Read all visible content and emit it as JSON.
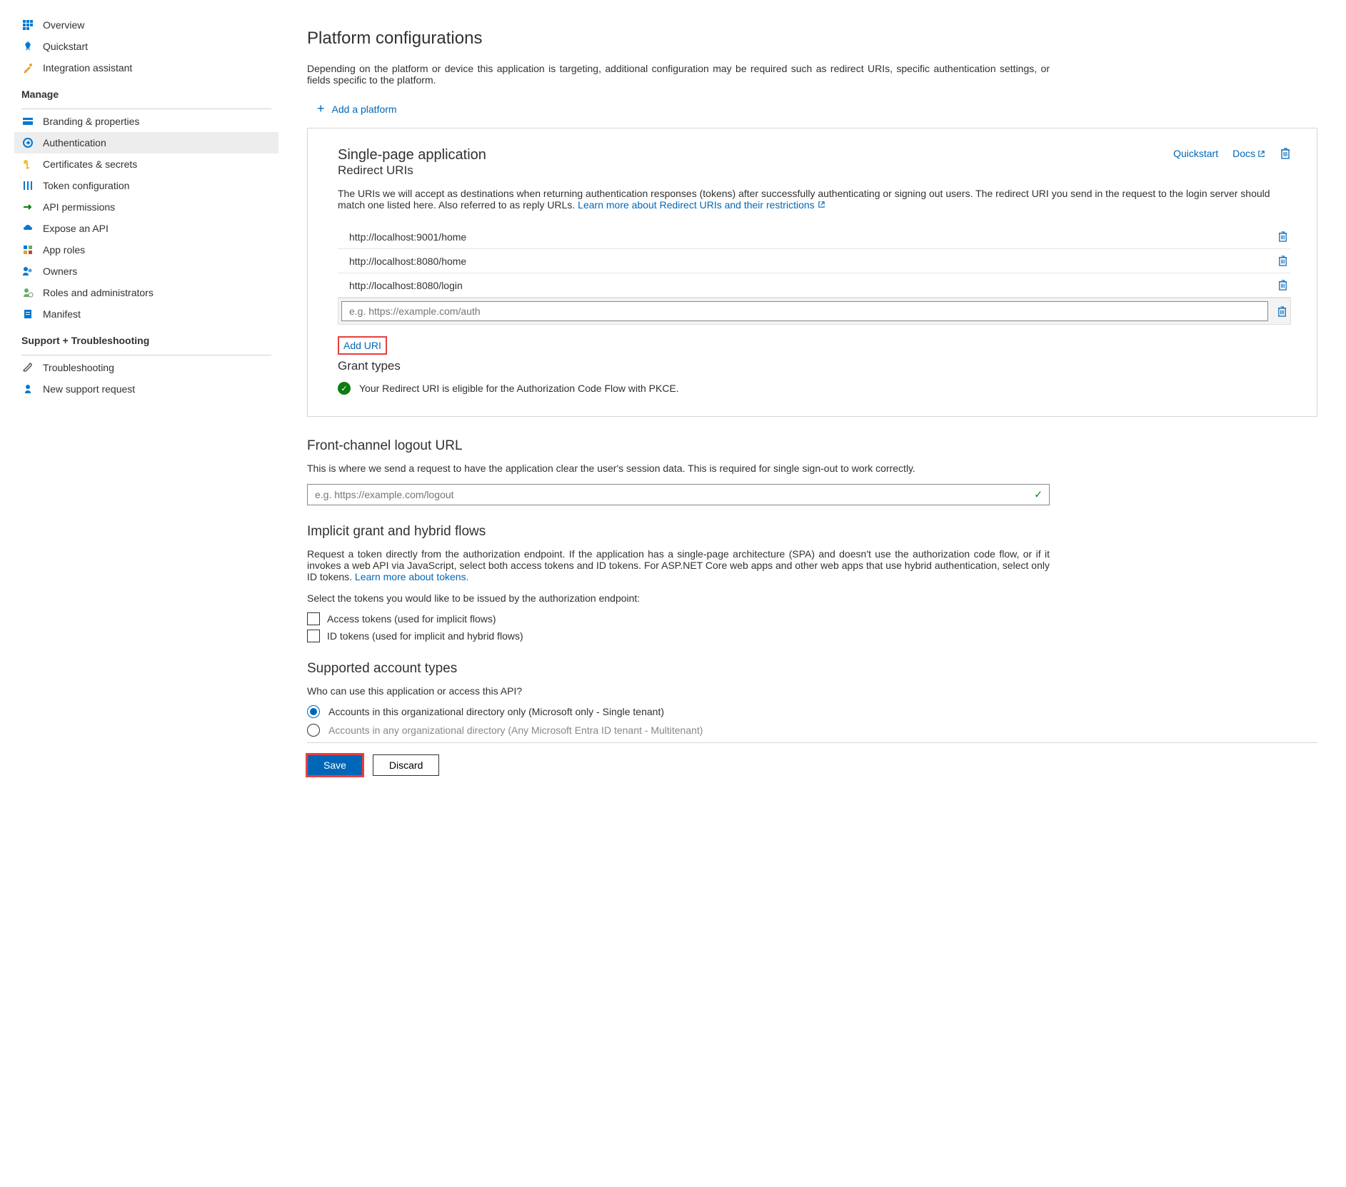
{
  "sidebar": {
    "overview": "Overview",
    "quickstart": "Quickstart",
    "integration": "Integration assistant",
    "manage_header": "Manage",
    "branding": "Branding & properties",
    "authentication": "Authentication",
    "certificates": "Certificates & secrets",
    "token_config": "Token configuration",
    "api_permissions": "API permissions",
    "expose_api": "Expose an API",
    "app_roles": "App roles",
    "owners": "Owners",
    "roles_admins": "Roles and administrators",
    "manifest": "Manifest",
    "support_header": "Support + Troubleshooting",
    "troubleshooting": "Troubleshooting",
    "new_support": "New support request"
  },
  "main": {
    "title": "Platform configurations",
    "description": "Depending on the platform or device this application is targeting, additional configuration may be required such as redirect URIs, specific authentication settings, or fields specific to the platform.",
    "add_platform": "Add a platform"
  },
  "spa": {
    "title": "Single-page application",
    "quickstart_link": "Quickstart",
    "docs_link": "Docs",
    "redirect_heading": "Redirect URIs",
    "redirect_desc": "The URIs we will accept as destinations when returning authentication responses (tokens) after successfully authenticating or signing out users. The redirect URI you send in the request to the login server should match one listed here. Also referred to as reply URLs. ",
    "learn_more_link": "Learn more about Redirect URIs and their restrictions",
    "uris": [
      "http://localhost:9001/home",
      "http://localhost:8080/home",
      "http://localhost:8080/login"
    ],
    "uri_placeholder": "e.g. https://example.com/auth",
    "add_uri": "Add URI",
    "grant_heading": "Grant types",
    "eligible_msg": "Your Redirect URI is eligible for the Authorization Code Flow with PKCE."
  },
  "logout": {
    "heading": "Front-channel logout URL",
    "desc": "This is where we send a request to have the application clear the user's session data. This is required for single sign-out to work correctly.",
    "placeholder": "e.g. https://example.com/logout"
  },
  "implicit": {
    "heading": "Implicit grant and hybrid flows",
    "desc1": "Request a token directly from the authorization endpoint. If the application has a single-page architecture (SPA) and doesn't use the authorization code flow, or if it invokes a web API via JavaScript, select both access tokens and ID tokens. For ASP.NET Core web apps and other web apps that use hybrid authentication, select only ID tokens. ",
    "learn_tokens": "Learn more about tokens.",
    "select_tokens": "Select the tokens you would like to be issued by the authorization endpoint:",
    "access_tokens": "Access tokens (used for implicit flows)",
    "id_tokens": "ID tokens (used for implicit and hybrid flows)"
  },
  "account_types": {
    "heading": "Supported account types",
    "question": "Who can use this application or access this API?",
    "single_tenant": "Accounts in this organizational directory only (Microsoft only - Single tenant)",
    "multi_tenant": "Accounts in any organizational directory (Any Microsoft Entra ID tenant - Multitenant)"
  },
  "footer": {
    "save": "Save",
    "discard": "Discard"
  }
}
